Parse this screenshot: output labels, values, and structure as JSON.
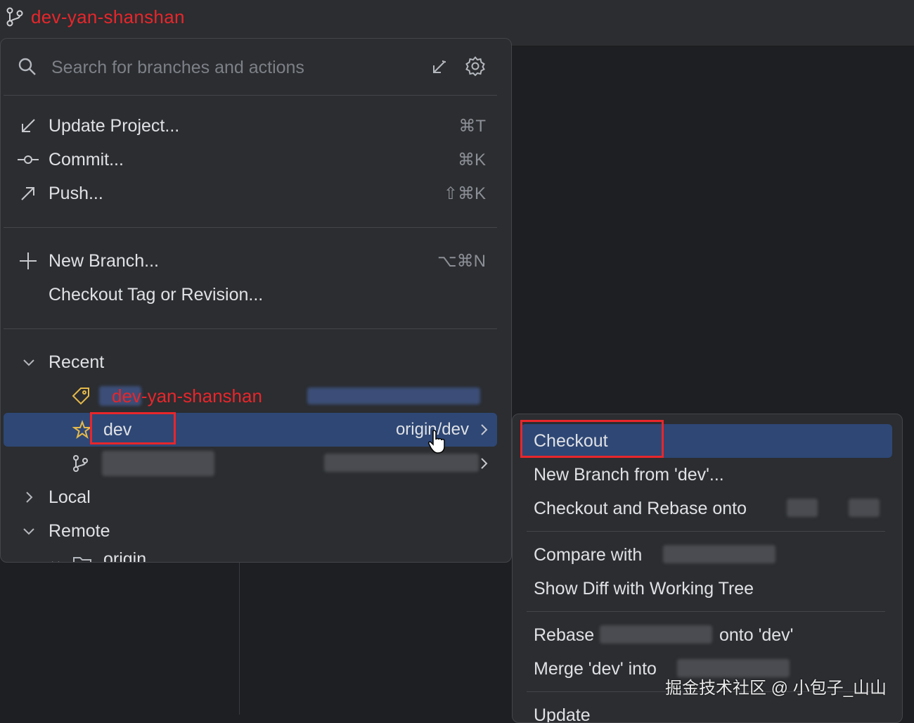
{
  "toolbar": {
    "current_branch": "dev-yan-shanshan"
  },
  "search": {
    "placeholder": "Search for branches and actions"
  },
  "actions": [
    {
      "label": "Update Project...",
      "shortcut": "⌘T",
      "icon": "update-arrow-icon"
    },
    {
      "label": "Commit...",
      "shortcut": "⌘K",
      "icon": "commit-icon"
    },
    {
      "label": "Push...",
      "shortcut": "⇧⌘K",
      "icon": "push-arrow-icon"
    },
    {
      "label": "New Branch...",
      "shortcut": "⌥⌘N",
      "icon": "plus-icon"
    },
    {
      "label": "Checkout Tag or Revision...",
      "shortcut": ""
    }
  ],
  "tree": {
    "recent_label": "Recent",
    "recent_items": [
      {
        "label": "dev-yan-shanshan",
        "icon": "tag-icon"
      },
      {
        "label": "dev",
        "tracking": "origin/dev",
        "icon": "star-icon"
      },
      {
        "label": "",
        "icon": "branch-icon"
      }
    ],
    "local_label": "Local",
    "remote_label": "Remote",
    "remote_child": "origin"
  },
  "submenu": {
    "items": [
      "Checkout",
      "New Branch from 'dev'...",
      "Checkout and Rebase onto",
      "Compare with",
      "Show Diff with Working Tree",
      "Rebase",
      "onto 'dev'",
      "Merge 'dev' into",
      "Update"
    ]
  },
  "watermark": "掘金技术社区 @ 小包子_山山",
  "colors": {
    "background": "#1e1f22",
    "popup": "#2b2d30",
    "selection": "#2e4775",
    "annotation_red": "#e8262b"
  }
}
